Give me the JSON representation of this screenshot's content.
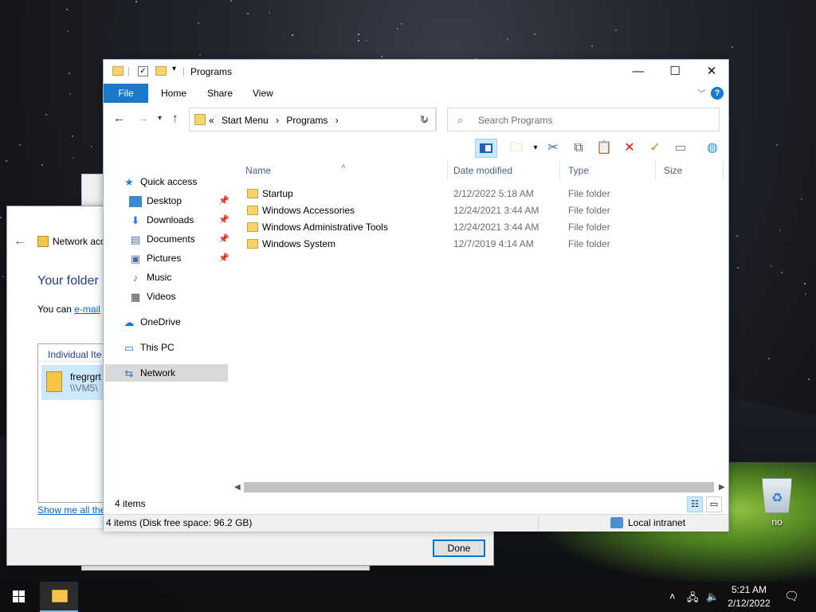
{
  "explorer": {
    "title": "Programs",
    "ribbon_tabs": [
      "File",
      "Home",
      "Share",
      "View"
    ],
    "address": {
      "prefix": "«",
      "crumbs": [
        "Start Menu",
        "Programs"
      ]
    },
    "search_placeholder": "Search Programs",
    "nav": {
      "quick_access": "Quick access",
      "pinned": [
        "Desktop",
        "Downloads",
        "Documents",
        "Pictures"
      ],
      "unpinned": [
        "Music",
        "Videos"
      ],
      "onedrive": "OneDrive",
      "this_pc": "This PC",
      "network": "Network"
    },
    "columns": [
      "Name",
      "Date modified",
      "Type",
      "Size"
    ],
    "rows": [
      {
        "name": "Startup",
        "date": "2/12/2022 5:18 AM",
        "type": "File folder"
      },
      {
        "name": "Windows Accessories",
        "date": "12/24/2021 3:44 AM",
        "type": "File folder"
      },
      {
        "name": "Windows Administrative Tools",
        "date": "12/24/2021 3:44 AM",
        "type": "File folder"
      },
      {
        "name": "Windows System",
        "date": "12/7/2019 4:14 AM",
        "type": "File folder"
      }
    ],
    "item_count": "4 items",
    "status_detail": "4 items (Disk free space: 96.2 GB)",
    "zone": "Local intranet"
  },
  "dialog": {
    "title": "Network acc",
    "heading": "Your folder i",
    "text_prefix": "You can ",
    "text_link": "e-mail",
    "list_header": "Individual Ite",
    "item_name": "fregrgrt",
    "item_path": "\\\\VM5\\",
    "show_link": "Show me all the",
    "done": "Done"
  },
  "desktop": {
    "recycle_label": "no"
  },
  "taskbar": {
    "time": "5:21 AM",
    "date": "2/12/2022"
  },
  "colors": {
    "accent": "#1979ca",
    "selection": "#cce8ff",
    "folder": "#f7d36b"
  }
}
